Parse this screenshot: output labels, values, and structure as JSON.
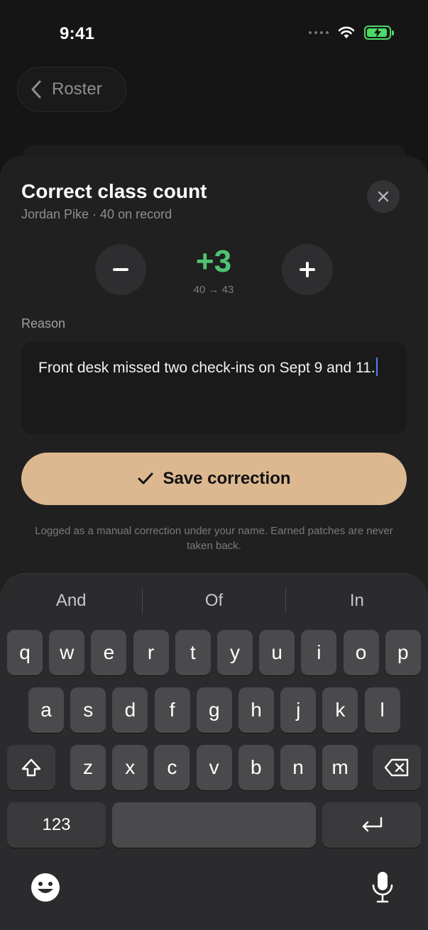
{
  "status_bar": {
    "time": "9:41"
  },
  "nav": {
    "back_label": "Roster"
  },
  "sheet": {
    "title": "Correct class count",
    "subtitle": "Jordan Pike · 40 on record",
    "delta": "+3",
    "range": "40 → 43",
    "reason_label": "Reason",
    "reason_text": "Front desk missed two check-ins on Sept 9 and 11.",
    "save_label": "Save correction",
    "footnote": "Logged as a manual correction under your name. Earned patches are never taken back."
  },
  "keyboard": {
    "suggestions": [
      "And",
      "Of",
      "In"
    ],
    "row1": [
      "q",
      "w",
      "e",
      "r",
      "t",
      "y",
      "u",
      "i",
      "o",
      "p"
    ],
    "row2": [
      "a",
      "s",
      "d",
      "f",
      "g",
      "h",
      "j",
      "k",
      "l"
    ],
    "row3": [
      "z",
      "x",
      "c",
      "v",
      "b",
      "n",
      "m"
    ],
    "numbers_label": "123"
  },
  "colors": {
    "accent_green": "#4fc46f",
    "save_button": "#dcb891",
    "caret": "#4f7cff"
  },
  "icons": [
    "chevron-left-icon",
    "close-icon",
    "minus-icon",
    "plus-icon",
    "checkmark-icon",
    "shift-icon",
    "backspace-icon",
    "return-icon",
    "emoji-icon",
    "microphone-icon",
    "wifi-icon",
    "battery-icon"
  ]
}
